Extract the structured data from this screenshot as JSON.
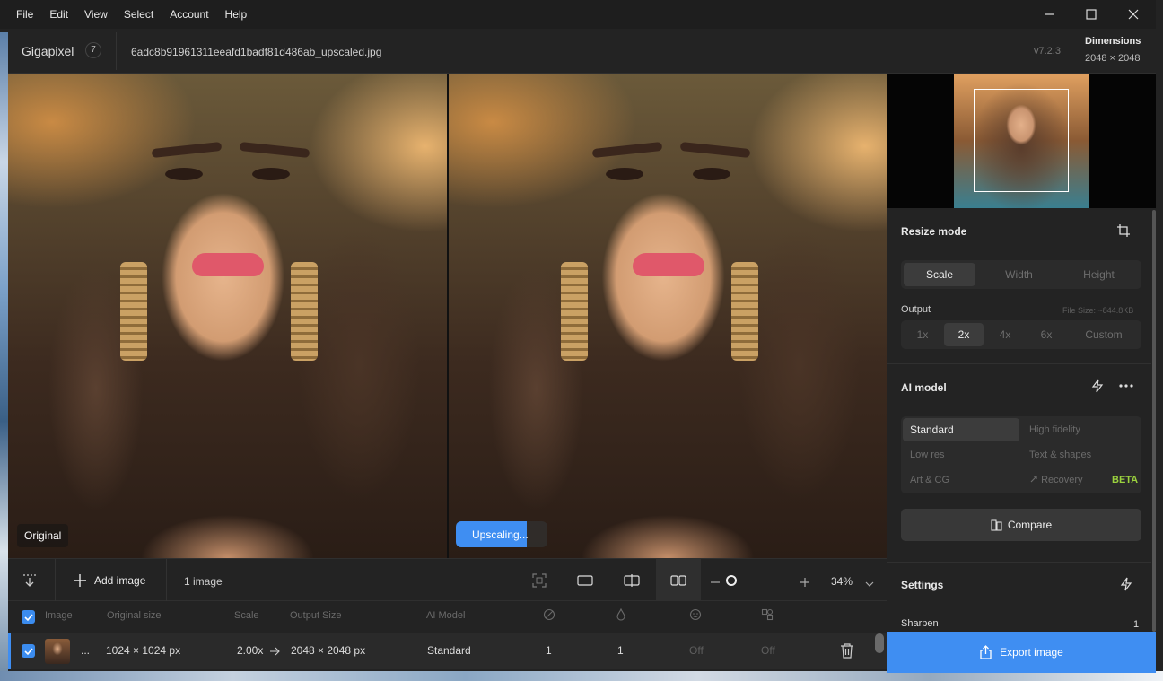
{
  "menu": [
    "File",
    "Edit",
    "View",
    "Select",
    "Account",
    "Help"
  ],
  "window_controls": {
    "minimize": "minimize-icon",
    "maximize": "maximize-icon",
    "close": "close-icon"
  },
  "header": {
    "app_name": "Gigapixel",
    "app_badge": "7",
    "filename": "6adc8b91961311eeafd1badf81d486ab_upscaled.jpg",
    "version": "v7.2.3",
    "dimensions_label": "Dimensions",
    "dimensions_value": "2048 × 2048"
  },
  "preview": {
    "left_label": "Original",
    "right_status": "Upscaling..."
  },
  "panel": {
    "resize_mode_title": "Resize mode",
    "resize_tabs": [
      "Scale",
      "Width",
      "Height"
    ],
    "resize_active": "Scale",
    "output_label": "Output",
    "file_size": "File Size: ~844.8KB",
    "output_options": [
      "1x",
      "2x",
      "4x",
      "6x",
      "Custom"
    ],
    "output_active": "2x",
    "ai_model_title": "AI model",
    "models": [
      "Standard",
      "High fidelity",
      "Low res",
      "Text & shapes",
      "Art & CG",
      "Recovery"
    ],
    "model_active": "Standard",
    "beta_tag": "BETA",
    "compare_label": "Compare",
    "settings_title": "Settings",
    "sharpen_label": "Sharpen",
    "sharpen_value": "1"
  },
  "toolbar": {
    "add_image": "Add image",
    "image_count": "1 image",
    "zoom": "34%",
    "zoom_level": 0.12
  },
  "table": {
    "headers": [
      "Image",
      "Original size",
      "Scale",
      "Output Size",
      "AI Model"
    ],
    "row": {
      "name": "...",
      "original_size": "1024 × 1024 px",
      "scale": "2.00x",
      "output_size": "2048 × 2048 px",
      "model": "Standard",
      "col1": "1",
      "col2": "1",
      "col3": "Off",
      "col4": "Off"
    }
  },
  "export_label": "Export image",
  "colors": {
    "accent": "#3f8ef2",
    "beta": "#9bd23e",
    "background": "#232323"
  }
}
